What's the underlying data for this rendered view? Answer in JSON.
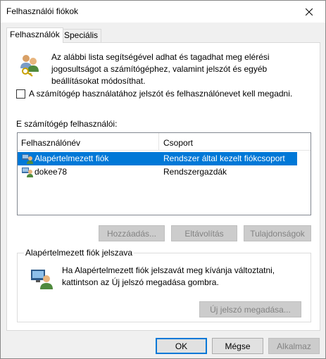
{
  "window": {
    "title": "Felhasználói fiókok"
  },
  "tabs": [
    {
      "label": "Felhasználók",
      "active": true
    },
    {
      "label": "Speciális",
      "active": false
    }
  ],
  "intro": {
    "text": "Az alábbi lista segítségével adhat és tagadhat meg elérési jogosultságot a számítógéphez, valamint jelszót és egyéb beállításokat módosíthat."
  },
  "require_login": {
    "label": "A számítógép használatához jelszót és felhasználónevet kell megadni.",
    "checked": false
  },
  "users": {
    "section_label": "E számítógép felhasználói:",
    "columns": [
      "Felhasználónév",
      "Csoport"
    ],
    "rows": [
      {
        "name": "Alapértelmezett fiók",
        "group": "Rendszer által kezelt fiókcsoport",
        "selected": true
      },
      {
        "name": "dokee78",
        "group": "Rendszergazdák",
        "selected": false
      }
    ]
  },
  "user_buttons": {
    "add": "Hozzáadás...",
    "remove": "Eltávolítás",
    "properties": "Tulajdonságok"
  },
  "password_group": {
    "title": "Alapértelmezett fiók jelszava",
    "text": "Ha Alapértelmezett fiók jelszavát meg kívánja változtatni, kattintson az Új jelszó megadása gombra.",
    "button": "Új jelszó megadása..."
  },
  "dialog_buttons": {
    "ok": "OK",
    "cancel": "Mégse",
    "apply": "Alkalmaz"
  },
  "colors": {
    "selection": "#0078d7",
    "dialog_bg": "#f0f0f0"
  }
}
